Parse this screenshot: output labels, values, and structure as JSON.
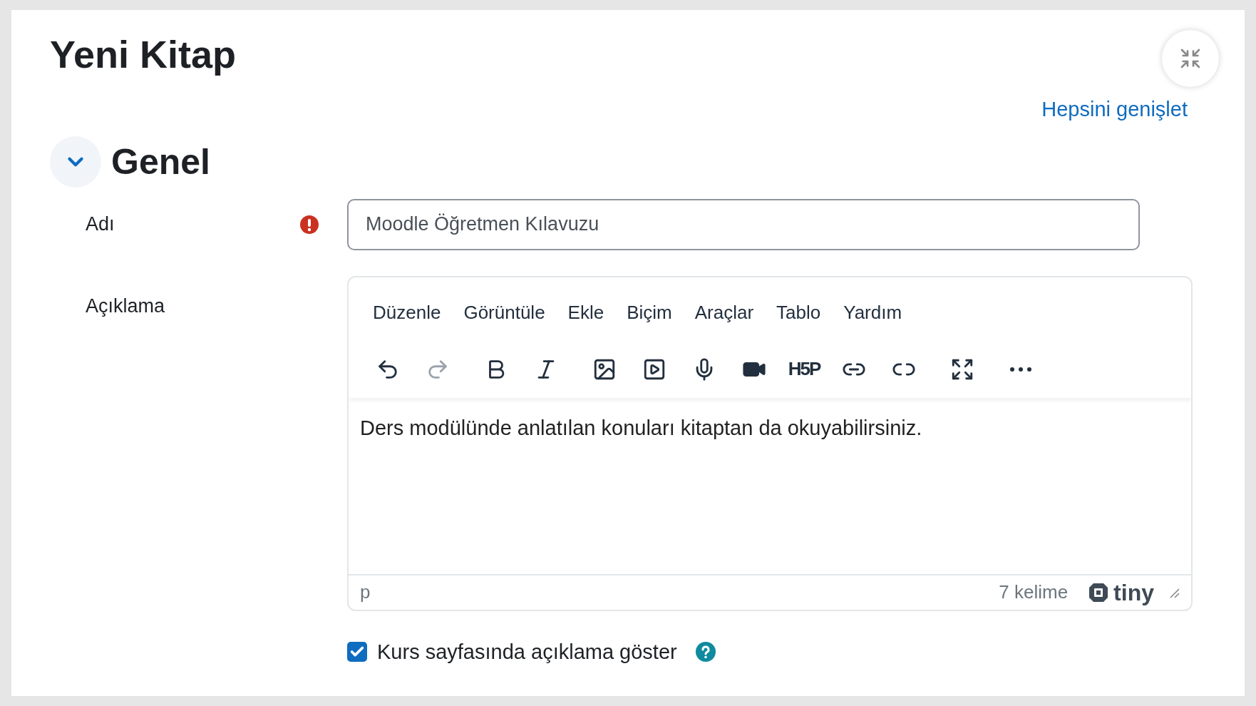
{
  "title": "Yeni Kitap",
  "expand_all_link": "Hepsini genişlet",
  "section": {
    "title": "Genel",
    "expanded": true
  },
  "name_field": {
    "label": "Adı",
    "required": true,
    "value": "Moodle Öğretmen Kılavuzu"
  },
  "description": {
    "label": "Açıklama",
    "menu": [
      "Düzenle",
      "Görüntüle",
      "Ekle",
      "Biçim",
      "Araçlar",
      "Tablo",
      "Yardım"
    ],
    "toolbar_groups": [
      [
        {
          "kind": "undo",
          "disabled": false
        },
        {
          "kind": "redo",
          "disabled": true
        }
      ],
      [
        {
          "kind": "bold",
          "disabled": false
        },
        {
          "kind": "italic",
          "disabled": false
        }
      ],
      [
        {
          "kind": "image",
          "disabled": false
        },
        {
          "kind": "media",
          "disabled": false
        },
        {
          "kind": "mic",
          "disabled": false
        },
        {
          "kind": "video",
          "disabled": false
        },
        {
          "kind": "h5p",
          "disabled": false,
          "text": "H5P"
        },
        {
          "kind": "link",
          "disabled": false
        },
        {
          "kind": "unlink",
          "disabled": false
        }
      ],
      [
        {
          "kind": "fullscreen",
          "disabled": false
        }
      ],
      [
        {
          "kind": "more",
          "disabled": false
        }
      ]
    ],
    "content": "Ders modülünde anlatılan konuları kitaptan da okuyabilirsiniz.",
    "path": "p",
    "word_count": "7 kelime",
    "brand": "tiny"
  },
  "show_description": {
    "label": "Kurs sayfasında açıklama göster",
    "checked": true
  }
}
